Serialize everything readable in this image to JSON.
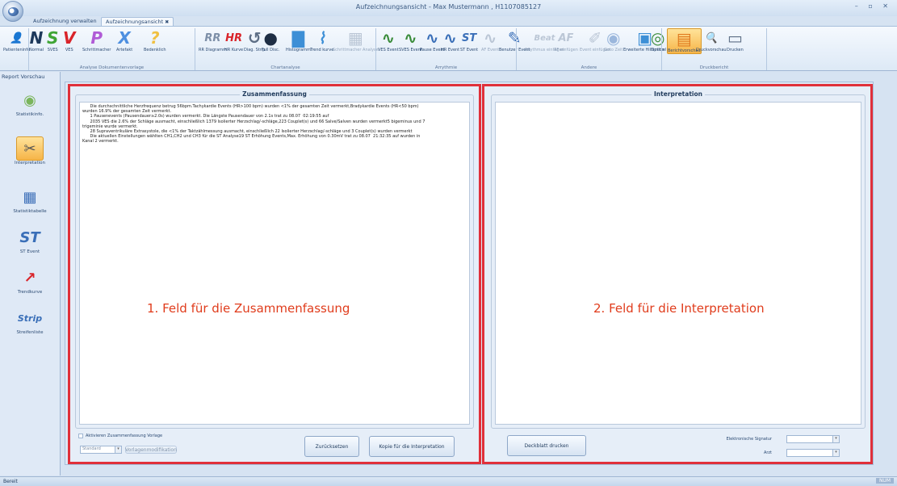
{
  "window": {
    "title": "Aufzeichnungsansicht - Max Mustermann , H1107085127",
    "controls": "– ▫ ✕"
  },
  "tabs": [
    {
      "label": "Aufzeichnung verwalten"
    },
    {
      "label": "Aufzeichnungsansicht",
      "close": "✖"
    }
  ],
  "ribbon": {
    "groups": [
      {
        "label": "Analyse Dokumentenvorlage"
      },
      {
        "label": "Chartanalyse"
      },
      {
        "label": "Arrythmie"
      },
      {
        "label": "Andere"
      },
      {
        "label": "Druckbericht"
      }
    ],
    "buttons": [
      {
        "label": "Patienteninfo",
        "glyph": "👤"
      },
      {
        "label": "Normal",
        "glyph": "N",
        "color": "#1e395b"
      },
      {
        "label": "SVES",
        "glyph": "S",
        "color": "#3fa535"
      },
      {
        "label": "VES",
        "glyph": "V",
        "color": "#d9242a"
      },
      {
        "label": "Schrittmacher",
        "glyph": "P",
        "color": "#b05bd6"
      },
      {
        "label": "Artefakt",
        "glyph": "X",
        "color": "#4d8fe0"
      },
      {
        "label": "Bedenklich",
        "glyph": "?",
        "color": "#f0c040"
      },
      {
        "label": "RR Diagramm",
        "glyph": "RR",
        "color": "#7d8fa8"
      },
      {
        "label": "HR Kurve",
        "glyph": "HR",
        "color": "#d9242a"
      },
      {
        "label": "Diag. Strip",
        "glyph": "↺",
        "color": "#5e6f86"
      },
      {
        "label": "Full Disc.",
        "glyph": "●",
        "color": "#1e2e44"
      },
      {
        "label": "Histogramm",
        "glyph": "▇",
        "color": "#3d8fd6"
      },
      {
        "label": "Trend kurve",
        "glyph": "⌇",
        "color": "#3d8fd6"
      },
      {
        "label": "Schrittmacher Analyse",
        "glyph": "▦",
        "color": "#7d8fa8",
        "disabled": true
      },
      {
        "label": "VES Event",
        "glyph": "∿",
        "color": "#3a8c3a"
      },
      {
        "label": "SVES Event",
        "glyph": "∿",
        "color": "#3a8c3a"
      },
      {
        "label": "Pause Event",
        "glyph": "∿",
        "color": "#3a6fb8"
      },
      {
        "label": "HR Event",
        "glyph": "∿",
        "color": "#3a6fb8"
      },
      {
        "label": "ST Event",
        "glyph": "ST",
        "color": "#3a6fb8"
      },
      {
        "label": "AF Event",
        "glyph": "∿",
        "color": "#7d8fa8",
        "disabled": true
      },
      {
        "label": "Benutzer Event",
        "glyph": "✎",
        "color": "#3a6fb8"
      },
      {
        "label": "Rhythmus einfügen",
        "glyph": "Beat",
        "color": "#7d8fa8",
        "disabled": true
      },
      {
        "label": "AF einfügen",
        "glyph": "AF",
        "color": "#7d8fa8",
        "disabled": true
      },
      {
        "label": "Event einfügen",
        "glyph": "✐",
        "color": "#7d8fa8",
        "disabled": true
      },
      {
        "label": "Goto Zeit",
        "glyph": "◉",
        "color": "#3a6fb8",
        "disabled": true
      },
      {
        "label": "Erweiterte Hilfsmittel",
        "glyph": "▣",
        "color": "#3d8fd6"
      },
      {
        "label": "Option",
        "glyph": "◎",
        "color": "#3a8c3a"
      },
      {
        "label": "Berichtvorschau",
        "glyph": "▤",
        "color": "#e07a1f",
        "selected": true
      },
      {
        "label": "Druckvorschau",
        "glyph": "🔍",
        "color": "#5e6f86"
      },
      {
        "label": "Drucken",
        "glyph": "▭",
        "color": "#5e6f86"
      }
    ]
  },
  "nav": {
    "header": "Report Vorschau",
    "items": [
      {
        "label": "Statistikinfo.",
        "glyph": "◉",
        "color": "#7ab55c"
      },
      {
        "label": "Interpretation",
        "glyph": "✂",
        "color": "#555",
        "selected": true
      },
      {
        "label": "Statistiktabelle",
        "glyph": "▦",
        "color": "#3d6fb8"
      },
      {
        "label": "ST Event",
        "glyph": "ST",
        "color": "#3a6fb8"
      },
      {
        "label": "Trendkurve",
        "glyph": "↗",
        "color": "#d9242a"
      },
      {
        "label": "Streifenliste",
        "glyph": "Strip",
        "color": "#3a6fb8"
      }
    ]
  },
  "summary": {
    "title": "Zusammenfassung",
    "lines": [
      "      Die durchschnittliche Herzfrequenz betrug 56bpm.Tachykardie Events (HR>100 bpm) wurden <1% der gesamten Zeit vermerkt,Bradykardie Events (HR<50 bpm)",
      "wurden 16.9% der gesamten Zeit vermerkt.",
      "      1 Pausenevents (Pausendauer≥2.0s) wurden vermerkt. Die Längste Pausendauer von 2.1s trat zu 08.07  02:19:55 auf",
      "      2035 VES die 2.6% der Schläge ausmacht, einschließlich 1379 Isolierter Herzschlag/-schläge,223 Couplet(s) und 66 Salve/Salven wurden vermerkt5 bigeminus und 7",
      "trigeminie wurde vermerkt.",
      "      28 Supraventrikuläre Extrasystole, die <1% der Taktzählmessung ausmacht, einschließlich 22 Isolierter Herzschlag/-schläge und 3 Couplet(s) wurden vermerkt",
      "      Die aktuellen Einstellungen wählten CH1,CH2 und CH3 für die ST Analyse19 ST Erhöhung Events,Max. Erhöhung von 0.30mV trat zu 08.07  21:32:35 auf wurden in",
      "Kanal 2 vermerkt."
    ],
    "overlay": "1. Feld für die Zusammenfassung",
    "checkbox_label": "Aktivieren Zusammenfassung Vorlage",
    "template_value": "Standard",
    "template_button": "Vorlagenmodifikation",
    "reset_button": "Zurücksetzen",
    "copy_button": "Kopie für die Interpretation"
  },
  "interpretation": {
    "title": "Interpretation",
    "overlay": "2. Feld für die Interpretation",
    "cover_button": "Deckblatt drucken",
    "signature_label": "Elektronische Signatur",
    "doctor_label": "Arzt"
  },
  "status": {
    "left": "Bereit",
    "right": "NUM"
  },
  "colors": {
    "highlight": "#e0303a",
    "overlay": "#e03c1c"
  }
}
